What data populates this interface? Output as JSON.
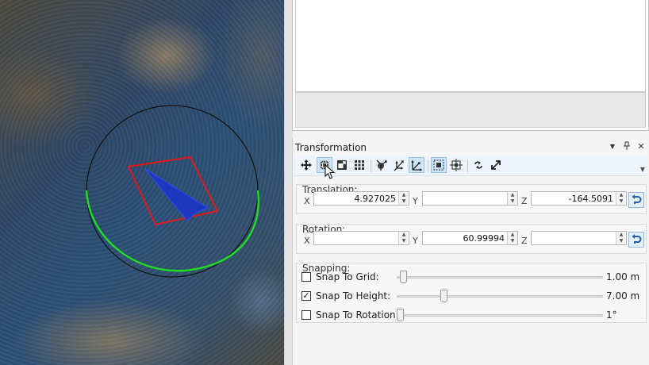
{
  "transformation": {
    "title": "Transformation",
    "header_buttons": {
      "dropdown": "▼",
      "pin": "📌",
      "close": "✕"
    },
    "toolbar": [
      {
        "name": "move-tool",
        "icon": "move-arrows-icon",
        "active": false
      },
      {
        "name": "rotate-tool",
        "icon": "rotate-sphere-icon",
        "active": true
      },
      {
        "name": "scale-tool",
        "icon": "scale-box-icon",
        "active": false
      },
      {
        "name": "grid-snap-tool",
        "icon": "grid-icon",
        "active": false
      },
      {
        "name": "local-space-tool",
        "icon": "local-axes-icon",
        "active": false
      },
      {
        "name": "pivot-tool",
        "icon": "pivot-axes-icon",
        "active": false
      },
      {
        "name": "world-space-tool",
        "icon": "world-axes-icon",
        "active": true
      },
      {
        "name": "bounds-tool",
        "icon": "bounds-icon",
        "active": true
      },
      {
        "name": "center-tool",
        "icon": "center-icon",
        "active": false
      },
      {
        "name": "link-tool",
        "icon": "link-icon",
        "active": false
      },
      {
        "name": "expand-tool",
        "icon": "expand-diagonal-icon",
        "active": false
      }
    ],
    "translation": {
      "title": "Translation:",
      "x_label": "X",
      "x": "4.927025",
      "y_label": "Y",
      "y": "",
      "z_label": "Z",
      "z": "-164.5091"
    },
    "rotation": {
      "title": "Rotation:",
      "x_label": "X",
      "x": "",
      "y_label": "Y",
      "y": "60.99994",
      "z_label": "Z",
      "z": ""
    },
    "snapping": {
      "title": "Snapping:",
      "rows": [
        {
          "label": "Snap To Grid:",
          "checked": false,
          "value": "1.00 m",
          "level": 0.0
        },
        {
          "label": "Snap To Height:",
          "checked": true,
          "value": "7.00 m",
          "level": 0.22
        },
        {
          "label": "Snap To Rotation:",
          "checked": false,
          "value": "1°",
          "level": 0.0
        }
      ]
    }
  },
  "colors": {
    "gizmo_ring": "#111111",
    "gizmo_green_arc": "#22dd22",
    "selection_box": "#e01818",
    "object_fill": "#1a33cc",
    "active_tool": "#cfe5fb",
    "reset_icon": "#1f5fae"
  }
}
